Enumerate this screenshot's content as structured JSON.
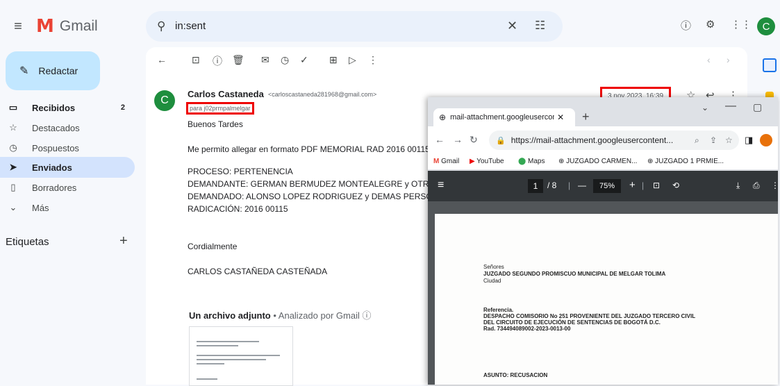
{
  "app": {
    "name": "Gmail"
  },
  "search": {
    "value": "in:sent"
  },
  "header": {
    "avatar_letter": "C"
  },
  "sidebar": {
    "compose_label": "Redactar",
    "items": [
      {
        "label": "Recibidos",
        "count": "2"
      },
      {
        "label": "Destacados"
      },
      {
        "label": "Pospuestos"
      },
      {
        "label": "Enviados"
      },
      {
        "label": "Borradores"
      },
      {
        "label": "Más"
      }
    ],
    "labels_title": "Etiquetas",
    "labels_add": "+"
  },
  "email": {
    "sender_initial": "C",
    "sender_name": "Carlos Castaneda",
    "sender_email": "<carloscastaneda281968@gmail.com>",
    "recipients": "para j02prmpalmelgar",
    "date": "3 nov 2023, 16:39",
    "body": [
      "Buenos Tardes",
      "Me permito allegar en formato PDF MEMORIAL RAD  2016 00115",
      "PROCESO: PERTENENCIA",
      "DEMANDANTE: GERMAN BERMUDEZ MONTEALEGRE y OTRO",
      "DEMANDADO: ALONSO LOPEZ RODRIGUEZ y DEMAS PERSONAS",
      "RADICACIÓN: 2016 00115",
      "Cordialmente",
      "CARLOS CASTAÑEDA CASTEÑADA"
    ],
    "attachment_title": "Un archivo adjunto",
    "attachment_note": " •  Analizado por Gmail ⓘ"
  },
  "browser": {
    "tab_title": "mail-attachment.googleusercon",
    "url": "https://mail-attachment.googleusercontent...",
    "bookmarks": [
      "Gmail",
      "YouTube",
      "Maps",
      "JUZGADO CARMEN...",
      "JUZGADO 1 PRMIE..."
    ],
    "pdf": {
      "page_current": "1",
      "page_total": "/ 8",
      "zoom": "75%",
      "lines": [
        "Señores",
        "JUZGADO SEGUNDO PROMISCUO MUNICIPAL DE MELGAR TOLIMA",
        "Ciudad",
        "Referencia.",
        "DESPACHO COMISORIO No 251 PROVENIENTE DEL JUZGADO TERCERO CIVIL",
        "DEL CIRCUITO DE EJECUCIÓN DE SENTENCIAS DE BOGOTÁ D.C.",
        "Rad. 734494089002-2023-0013-00",
        "ASUNTO: RECUSACION"
      ]
    }
  }
}
